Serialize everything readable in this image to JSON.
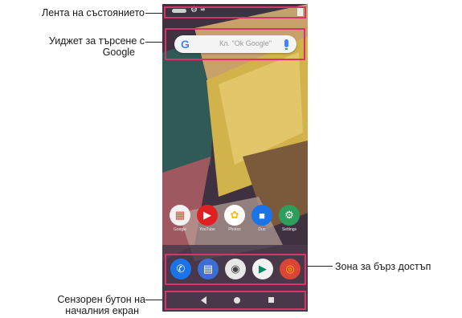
{
  "callouts": {
    "status_bar": "Лента на състоянието",
    "google_widget_line1": "Уиджет за търсене с",
    "google_widget_line2": "Google",
    "quick_access": "Зона за бърз достъп",
    "home_button_line1": "Сензорен бутон на",
    "home_button_line2": "началния екран"
  },
  "search_widget": {
    "logo": "G",
    "hint": "Кл. \"Ok Google\""
  },
  "apps": [
    {
      "name": "Google",
      "icon": "google-folder-icon",
      "color": "#ea4335",
      "glyph": "▦"
    },
    {
      "name": "YouTube",
      "icon": "youtube-icon",
      "color": "#e02020",
      "glyph": "▶"
    },
    {
      "name": "Photos",
      "icon": "photos-icon",
      "color": "#fbbc05",
      "glyph": "✿"
    },
    {
      "name": "Duo",
      "icon": "duo-icon",
      "color": "#1a73e8",
      "glyph": "■"
    },
    {
      "name": "Settings",
      "icon": "settings-icon",
      "color": "#2e9f5b",
      "glyph": "⚙"
    }
  ],
  "dock": [
    {
      "icon": "phone-icon",
      "color": "#1a73e8",
      "glyph": "✆"
    },
    {
      "icon": "messages-icon",
      "color": "#3b6fd6",
      "glyph": "▤"
    },
    {
      "icon": "camera-icon",
      "color": "#e8e8e8",
      "glyph": "◉"
    },
    {
      "icon": "play-store-icon",
      "color": "#f2f2f2",
      "glyph": "▶"
    },
    {
      "icon": "chrome-icon",
      "color": "#db4437",
      "glyph": "◎"
    }
  ],
  "colors": {
    "highlight": "#d8336a"
  }
}
